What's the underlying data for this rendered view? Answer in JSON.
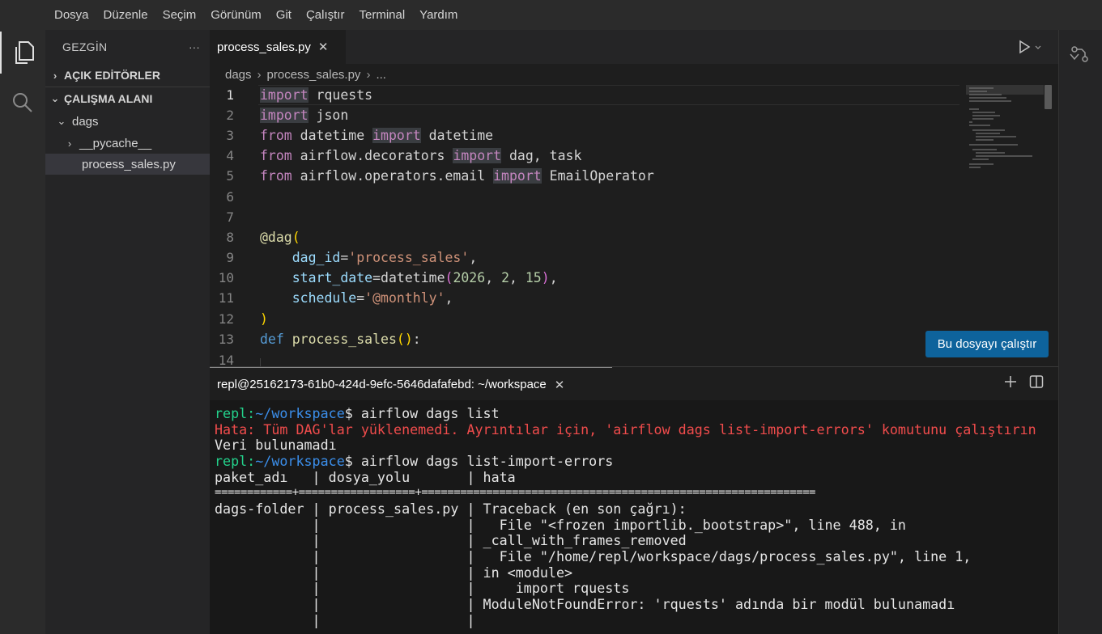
{
  "menu": [
    "Dosya",
    "Düzenle",
    "Seçim",
    "Görünüm",
    "Git",
    "Çalıştır",
    "Terminal",
    "Yardım"
  ],
  "sidebar": {
    "title": "GEZGİN",
    "more": "···",
    "sections": {
      "open_editors": "AÇIK EDİTÖRLER",
      "workspace": "ÇALIŞMA ALANI"
    },
    "tree": {
      "dags": "dags",
      "pycache": "__pycache__",
      "file": "process_sales.py"
    }
  },
  "editor": {
    "tab_label": "process_sales.py",
    "breadcrumb": [
      "dags",
      "process_sales.py",
      "..."
    ],
    "run_button": "Bu dosyayı çalıştır"
  },
  "terminal": {
    "tab_label": "repl@25162173-61b0-424d-9efc-5646dafafebd: ~/workspace",
    "prompt_user": "repl:",
    "prompt_path": "~/workspace",
    "prompt_sign": "$ ",
    "cmd1": "airflow dags list",
    "error1": "Hata: Tüm DAG'lar yüklenemedi. Ayrıntılar için, 'airflow dags list-import-errors' komutunu çalıştırın",
    "no_data": "Veri bulunamadı",
    "cmd2": "airflow dags list-import-errors",
    "table_header": "paket_adı   | dosya_yolu       | hata",
    "table_rule": "============+==================+=============================================================",
    "rows": [
      "dags-folder | process_sales.py | Traceback (en son çağrı):",
      "            |                  |   File \"<frozen importlib._bootstrap>\", line 488, in",
      "            |                  | _call_with_frames_removed",
      "            |                  |   File \"/home/repl/workspace/dags/process_sales.py\", line 1,",
      "            |                  | in <module>",
      "            |                  |     import rquests",
      "            |                  | ModuleNotFoundError: 'rquests' adında bir modül bulunamadı",
      "            |                  |"
    ]
  },
  "colors": {
    "run_button_bg": "#0e639c",
    "prompt_user": "#23d18b",
    "prompt_path": "#3b8eea",
    "error": "#f14c4c"
  }
}
